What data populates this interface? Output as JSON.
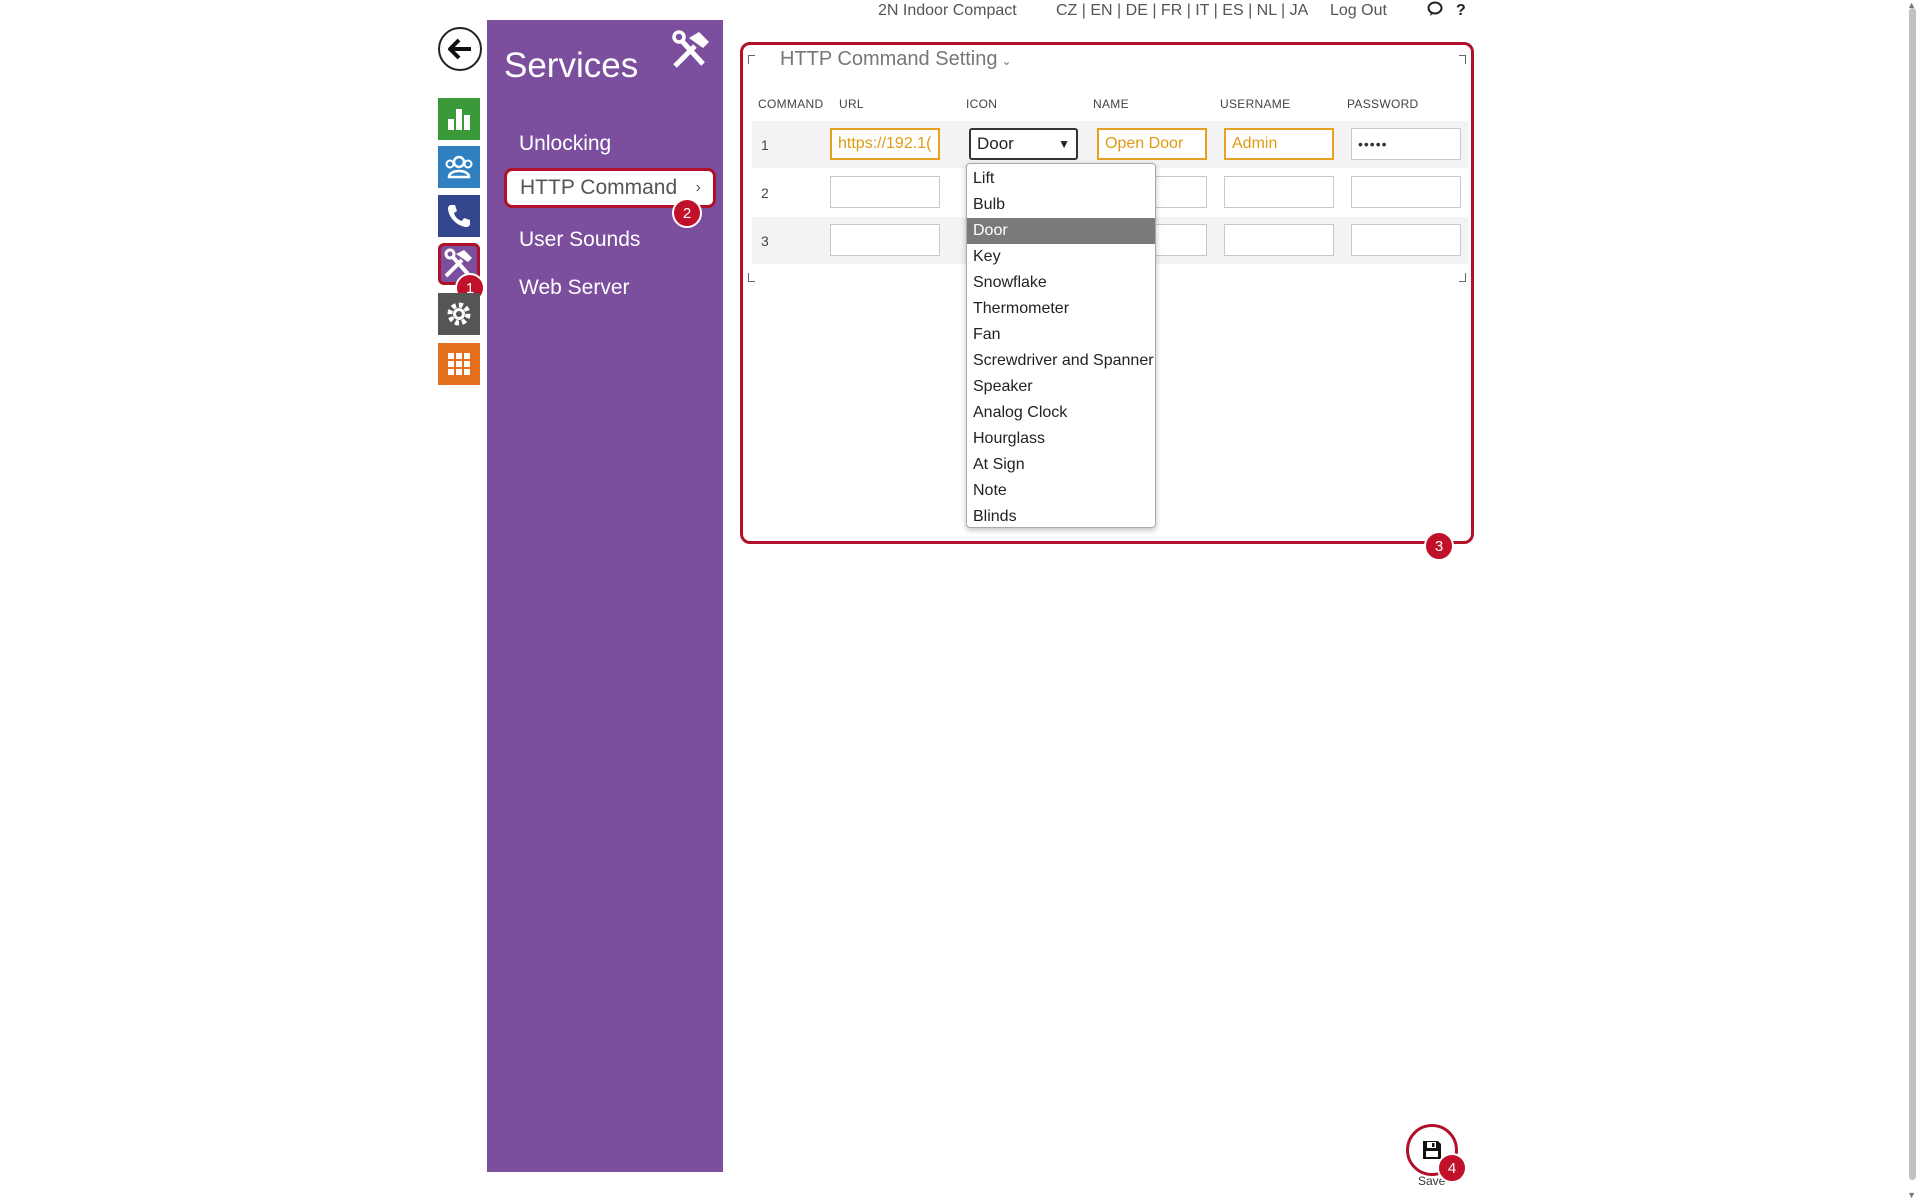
{
  "topbar": {
    "device_name": "2N Indoor Compact",
    "languages": "CZ | EN | DE | FR | IT | ES | NL | JA",
    "logout": "Log Out",
    "help": "?"
  },
  "rail": {
    "items": [
      {
        "icon": "status-chart-icon",
        "color": "#3a9a3a"
      },
      {
        "icon": "directory-users-icon",
        "color": "#2f7fc1"
      },
      {
        "icon": "phone-icon",
        "color": "#34468e"
      },
      {
        "icon": "services-tools-icon",
        "color": "#7b4f9e",
        "badge": "1"
      },
      {
        "icon": "settings-gear-icon",
        "color": "#555555"
      },
      {
        "icon": "system-grid-icon",
        "color": "#e4701e"
      }
    ]
  },
  "sidebar": {
    "title": "Services",
    "items": [
      {
        "label": "Unlocking"
      },
      {
        "label": "HTTP Command",
        "badge": "2"
      },
      {
        "label": "User Sounds"
      },
      {
        "label": "Web Server"
      }
    ]
  },
  "panel": {
    "title": "HTTP Command Setting",
    "badge": "3",
    "columns": [
      "COMMAND",
      "URL",
      "ICON",
      "NAME",
      "USERNAME",
      "PASSWORD"
    ],
    "rows": [
      {
        "command": "1",
        "url": "https://192.1(",
        "icon": "Door",
        "name": "Open Door",
        "username": "Admin",
        "password": "•••••"
      },
      {
        "command": "2",
        "url": "",
        "icon": "",
        "name": "",
        "username": "",
        "password": ""
      },
      {
        "command": "3",
        "url": "",
        "icon": "",
        "name": "",
        "username": "",
        "password": ""
      }
    ]
  },
  "dropdown": {
    "selected": "Door",
    "options": [
      "Lift",
      "Bulb",
      "Door",
      "Key",
      "Snowflake",
      "Thermometer",
      "Fan",
      "Screwdriver and Spanner",
      "Speaker",
      "Analog Clock",
      "Hourglass",
      "At Sign",
      "Note",
      "Blinds"
    ]
  },
  "save": {
    "label": "Save",
    "badge": "4"
  },
  "colors": {
    "sidebar": "#7b4f9e",
    "highlight": "#b0102a",
    "field_highlight": "#e8a020"
  }
}
